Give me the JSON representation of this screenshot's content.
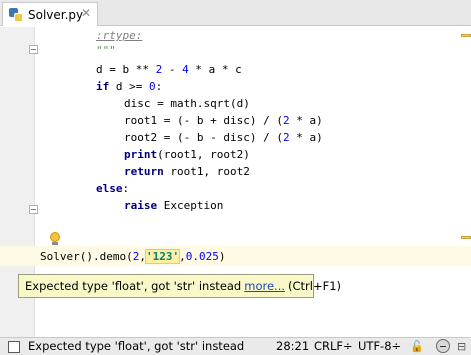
{
  "tab": {
    "label": "Solver.py",
    "close_glyph": "✕",
    "icon": "python-file-icon"
  },
  "code": {
    "rtype": ":rtype:",
    "docend": "\"\"\"",
    "l3_a": "d = b ** ",
    "l3_n1": "2",
    "l3_b": " - ",
    "l3_n2": "4",
    "l3_c": " * a * c",
    "l4_kw": "if",
    "l4_a": " d >= ",
    "l4_n": "0",
    "l4_b": ":",
    "l5": "disc = math.sqrt(d)",
    "l6_a": "root1 = (- b + disc) / (",
    "l6_n": "2",
    "l6_b": " * a)",
    "l7_a": "root2 = (- b - disc) / (",
    "l7_n": "2",
    "l7_b": " * a)",
    "l8_kw": "print",
    "l8_a": "(root1, root2)",
    "l9_kw": "return",
    "l9_a": " root1, root2",
    "l10_kw": "else",
    "l10_a": ":",
    "l11_kw": "raise",
    "l11_a": " Exception",
    "l12_a": "Solver().demo(",
    "l12_n1": "2",
    "l12_b": ",",
    "l12_s": "'123'",
    "l12_c": ",",
    "l12_n2": "0.025",
    "l12_d": ")"
  },
  "tooltip": {
    "message": "Expected type 'float', got 'str' instead",
    "link": "more...",
    "shortcut": "(Ctrl+F1)"
  },
  "status": {
    "message": "Expected type 'float', got 'str' instead",
    "position": "28:21",
    "line_sep": "CRLF÷",
    "encoding": "UTF-8÷",
    "lock": "🔓",
    "fold": "⊟"
  },
  "colors": {
    "keyword": "#000080",
    "number": "#0000ff",
    "docstring": "#629755",
    "string": "#008080",
    "tooltip_bg": "#f8f8c8"
  }
}
